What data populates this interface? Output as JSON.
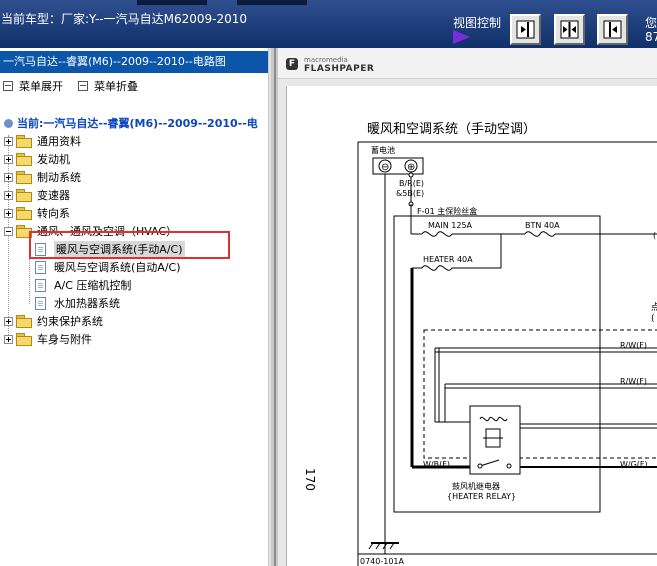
{
  "topbar": {
    "car_model": "当前车型：厂家:Y--一汽马自达M62009-2010",
    "view_control": "视图控制",
    "buttons": [
      {
        "name": "show-right-pane",
        "icon": "dock-right-icon"
      },
      {
        "name": "split-view",
        "icon": "split-icon"
      },
      {
        "name": "show-left-pane",
        "icon": "dock-left-icon"
      }
    ],
    "help_text": "您\n87"
  },
  "left_panel": {
    "title": "一汽马自达--睿翼(M6)--2009--2010--电路图",
    "expand_all": "菜单展开",
    "collapse_all": "菜单折叠",
    "current": "当前:一汽马自达--睿翼(M6)--2009--2010--电",
    "tree": [
      {
        "label": "通用资料",
        "state": "collapsed"
      },
      {
        "label": "发动机",
        "state": "collapsed"
      },
      {
        "label": "制动系统",
        "state": "collapsed"
      },
      {
        "label": "变速器",
        "state": "collapsed"
      },
      {
        "label": "转向系",
        "state": "collapsed"
      },
      {
        "label": "通风、通风及空调（HVAC）",
        "state": "expanded",
        "children": [
          {
            "label": "暖风与空调系统(手动A/C)",
            "selected": true
          },
          {
            "label": "暖风与空调系统(自动A/C)"
          },
          {
            "label": "A/C 压缩机控制"
          },
          {
            "label": "水加热器系统"
          }
        ]
      },
      {
        "label": "约束保护系统",
        "state": "collapsed"
      },
      {
        "label": "车身与附件",
        "state": "collapsed"
      }
    ]
  },
  "viewer": {
    "brand": "macromedia",
    "product": "FLASHPAPER",
    "logo_glyph": "F",
    "diagram": {
      "title": "暖风和空调系统（手动空调）",
      "battery": "蓄电池",
      "battery_minus": "⊖",
      "battery_plus": "⊕",
      "wire_br_1": "B/R(E)",
      "wire_br_2": "&5B(E)",
      "fuse_box": "F-01 主保险丝盒",
      "fuse_main": "MAIN 125A",
      "fuse_btn": "BTN 40A",
      "fuse_heater": "HEATER 40A",
      "side_char": "点",
      "paren_char": "(",
      "wire_rw_1": "R/W(F)",
      "wire_rw_2": "R/W(F)",
      "wire_wb": "W/B(F)",
      "wire_wg": "W/G(F)",
      "relay_cn": "鼓风机继电器",
      "relay_en": "{HEATER RELAY}",
      "page_number": "170",
      "doc_code": "0740-101A"
    }
  }
}
